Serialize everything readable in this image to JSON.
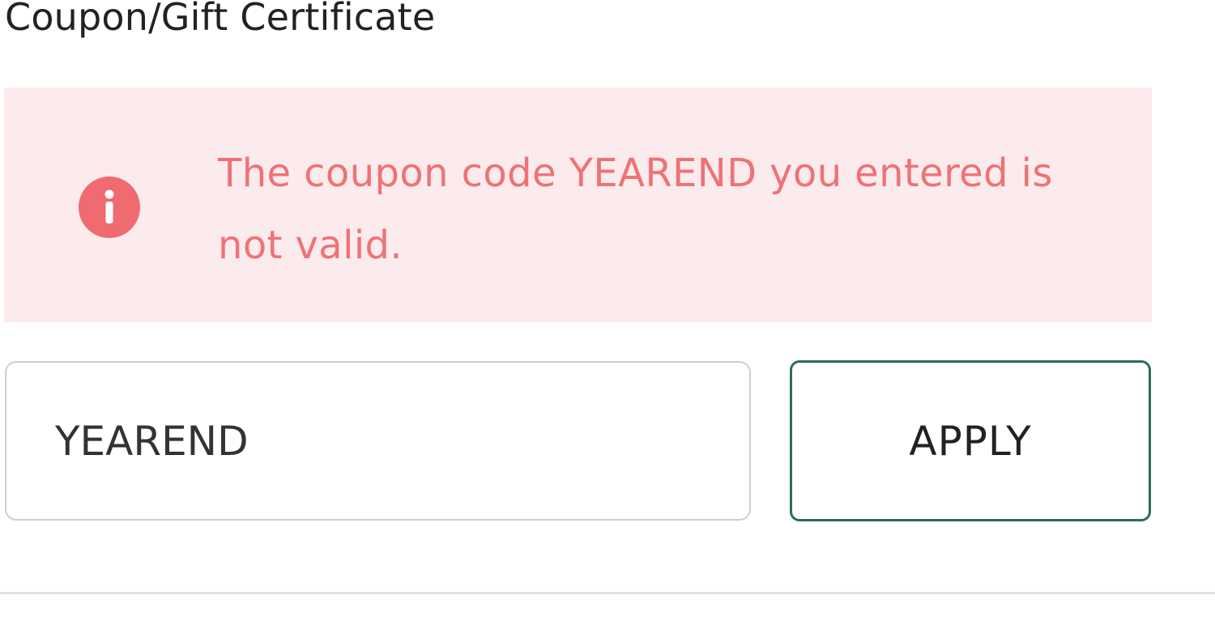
{
  "section": {
    "title": "Coupon/Gift Certificate"
  },
  "alert": {
    "icon": "info-icon",
    "message": "The coupon code YEAREND you entered is not valid.",
    "background_color": "#fcebed",
    "text_color": "#ee7276",
    "icon_color": "#ef6b70"
  },
  "coupon": {
    "input_value": "YEAREND",
    "apply_label": "APPLY",
    "button_border_color": "#2a6f53"
  }
}
